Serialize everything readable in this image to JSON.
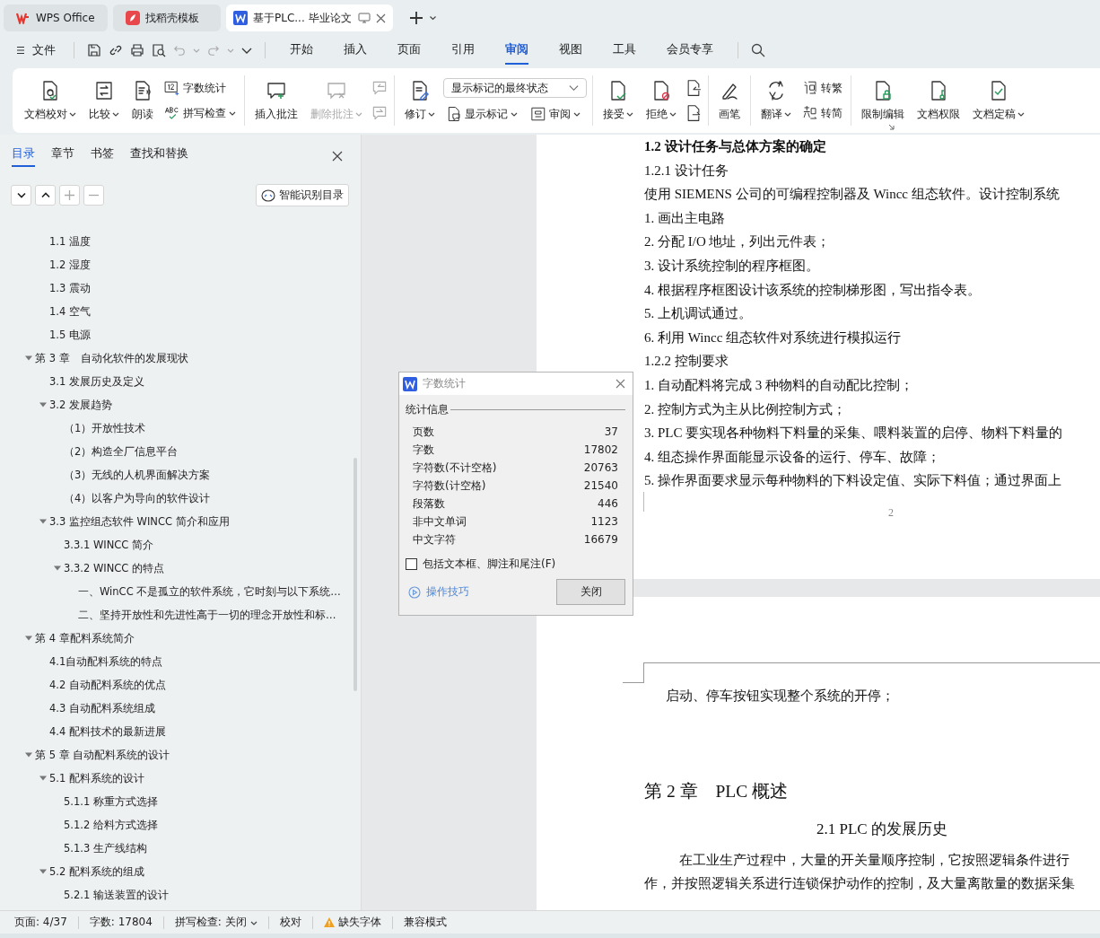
{
  "app_tabs": [
    {
      "kind": "wps",
      "label": "WPS Office",
      "selected": false
    },
    {
      "kind": "template",
      "label": "找稻壳模板",
      "selected": false
    },
    {
      "kind": "document",
      "label": "基于PLC... 毕业论文",
      "selected": true
    }
  ],
  "menu": {
    "file": "文件",
    "tabs": [
      {
        "label": "开始",
        "selected": false
      },
      {
        "label": "插入",
        "selected": false
      },
      {
        "label": "页面",
        "selected": false
      },
      {
        "label": "引用",
        "selected": false
      },
      {
        "label": "审阅",
        "selected": true
      },
      {
        "label": "视图",
        "selected": false
      },
      {
        "label": "工具",
        "selected": false
      },
      {
        "label": "会员专享",
        "selected": false
      }
    ]
  },
  "ribbon": {
    "groups": [
      {
        "items": [
          {
            "kind": "big",
            "label": "文档校对",
            "dropdown": true,
            "disabled": false
          },
          {
            "kind": "big",
            "label": "比较",
            "dropdown": true,
            "disabled": false
          },
          {
            "kind": "big",
            "label": "朗读",
            "dropdown": false,
            "disabled": false
          },
          {
            "kind": "stack",
            "items": [
              {
                "label": "字数统计",
                "dropdown": false
              },
              {
                "label": "拼写检查",
                "dropdown": true
              }
            ]
          }
        ]
      },
      {
        "items": [
          {
            "kind": "big",
            "label": "插入批注",
            "dropdown": false,
            "disabled": false
          },
          {
            "kind": "big",
            "label": "删除批注",
            "dropdown": true,
            "disabled": true
          },
          {
            "kind": "icons",
            "disabled": true
          }
        ]
      },
      {
        "items": [
          {
            "kind": "big",
            "label": "修订",
            "dropdown": true,
            "disabled": false
          },
          {
            "kind": "markup",
            "field": "显示标记的最终状态",
            "items": [
              {
                "label": "显示标记",
                "dropdown": true
              },
              {
                "label": "审阅",
                "dropdown": true
              }
            ]
          }
        ]
      },
      {
        "items": [
          {
            "kind": "big",
            "label": "接受",
            "dropdown": true,
            "disabled": false
          },
          {
            "kind": "big",
            "label": "拒绝",
            "dropdown": true,
            "disabled": false
          },
          {
            "kind": "icons",
            "disabled": false
          }
        ]
      },
      {
        "items": [
          {
            "kind": "big",
            "label": "画笔",
            "dropdown": false,
            "disabled": false
          }
        ]
      },
      {
        "items": [
          {
            "kind": "big",
            "label": "翻译",
            "dropdown": true,
            "disabled": false
          },
          {
            "kind": "stack",
            "items": [
              {
                "label": "转繁",
                "dropdown": false
              },
              {
                "label": "转简",
                "dropdown": false
              }
            ]
          }
        ]
      },
      {
        "items": [
          {
            "kind": "big",
            "label": "限制编辑",
            "dropdown": false,
            "disabled": false
          },
          {
            "kind": "big",
            "label": "文档权限",
            "dropdown": false,
            "disabled": false
          },
          {
            "kind": "big",
            "label": "文档定稿",
            "dropdown": true,
            "disabled": false
          }
        ]
      }
    ]
  },
  "sidebar": {
    "tabs": [
      {
        "label": "目录",
        "selected": true
      },
      {
        "label": "章节",
        "selected": false
      },
      {
        "label": "书签",
        "selected": false
      },
      {
        "label": "查找和替换",
        "selected": false
      }
    ],
    "smart_button": "智能识别目录",
    "toc": {
      "leading_items": [
        {
          "label": "1.1  温度"
        },
        {
          "label": "1.2  湿度"
        },
        {
          "label": "1.3  震动"
        },
        {
          "label": "1.4  空气"
        },
        {
          "label": "1.5  电源"
        }
      ],
      "chapters": [
        {
          "label": "第 3 章　自动化软件的发展现状",
          "expanded": true,
          "children": [
            {
              "label": "3.1 发展历史及定义"
            },
            {
              "label": "3.2 发展趋势",
              "expanded": true,
              "children": [
                {
                  "label": "（1）开放性技术"
                },
                {
                  "label": "（2）构造全厂信息平台"
                },
                {
                  "label": "（3）无线的人机界面解决方案"
                },
                {
                  "label": "（4）以客户为导向的软件设计"
                }
              ]
            },
            {
              "label": "3.3 监控组态软件 WINCC 简介和应用",
              "expanded": true,
              "children": [
                {
                  "label": "3.3.1 WINCC 简介"
                },
                {
                  "label": "3.3.2 WINCC 的特点",
                  "expanded": true,
                  "children": [
                    {
                      "label": "一、WinCC 不是孤立的软件系统，它时刻与以下系统…"
                    },
                    {
                      "label": "二、坚持开放性和先进性高于一切的理念开放性和标…"
                    }
                  ]
                }
              ]
            }
          ]
        },
        {
          "label": "第 4 章配料系统简介",
          "expanded": true,
          "children": [
            {
              "label": "4.1自动配料系统的特点"
            },
            {
              "label": "4.2  自动配料系统的优点"
            },
            {
              "label": "4.3  自动配料系统组成"
            },
            {
              "label": "4.4    配料技术的最新进展"
            }
          ]
        },
        {
          "label": "第 5 章  自动配料系统的设计",
          "expanded": true,
          "children": [
            {
              "label": "5.1  配料系统的设计",
              "expanded": true,
              "children": [
                {
                  "label": "5.1.1  称重方式选择"
                },
                {
                  "label": "5.1.2  给料方式选择"
                },
                {
                  "label": "5.1.3  生产线结构"
                }
              ]
            },
            {
              "label": "5.2  配料系统的组成",
              "expanded": true,
              "children": [
                {
                  "label": "5.2.1  输送装置的设计"
                }
              ]
            }
          ]
        }
      ]
    }
  },
  "document": {
    "page_1": [
      {
        "kind": "bold_heading",
        "text": "1.2 设计任务与总体方案的确定"
      },
      {
        "kind": "line",
        "text": "1.2.1 设计任务"
      },
      {
        "kind": "line",
        "text": "使用 SIEMENS 公司的可编程控制器及 Wincc 组态软件。设计控制系统"
      },
      {
        "kind": "line",
        "text": "1.  画出主电路"
      },
      {
        "kind": "line",
        "text": "2.  分配 I/O 地址，列出元件表；"
      },
      {
        "kind": "line",
        "text": "3.  设计系统控制的程序框图。"
      },
      {
        "kind": "line",
        "text": "4.  根据程序框图设计该系统的控制梯形图，写出指令表。"
      },
      {
        "kind": "line",
        "text": "5.  上机调试通过。"
      },
      {
        "kind": "line",
        "text": "6.  利用 Wincc 组态软件对系统进行模拟运行"
      },
      {
        "kind": "line",
        "text": "1.2.2  控制要求"
      },
      {
        "kind": "line",
        "text": "1.   自动配料将完成 3 种物料的自动配比控制；"
      },
      {
        "kind": "line",
        "text": "2.   控制方式为主从比例控制方式；"
      },
      {
        "kind": "line",
        "text": "3.   PLC 要实现各种物料下料量的采集、喂料装置的启停、物料下料量的"
      },
      {
        "kind": "line",
        "text": "4.   组态操作界面能显示设备的运行、停车、故障；"
      },
      {
        "kind": "line",
        "text": "5.   操作界面要求显示每种物料的下料设定值、实际下料值；通过界面上"
      }
    ],
    "page_number": "2",
    "page_2": [
      {
        "kind": "line",
        "text": "启动、停车按钮实现整个系统的开停；"
      },
      {
        "kind": "chapter_title",
        "text": "第 2 章　PLC 概述"
      },
      {
        "kind": "section_title",
        "text": "2.1 PLC 的发展历史"
      },
      {
        "kind": "indented",
        "text": "在工业生产过程中，大量的开关量顺序控制，它按照逻辑条件进行"
      },
      {
        "kind": "line",
        "text": "作，并按照逻辑关系进行连锁保护动作的控制，及大量离散量的数据采集"
      }
    ]
  },
  "dialog": {
    "title": "字数统计",
    "group": "统计信息",
    "stats": [
      {
        "label": "页数",
        "value": "37"
      },
      {
        "label": "字数",
        "value": "17802"
      },
      {
        "label": "字符数(不计空格)",
        "value": "20763"
      },
      {
        "label": "字符数(计空格)",
        "value": "21540"
      },
      {
        "label": "段落数",
        "value": "446"
      },
      {
        "label": "非中文单词",
        "value": "1123"
      },
      {
        "label": "中文字符",
        "value": "16679"
      }
    ],
    "include_option": {
      "label": "包括文本框、脚注和尾注(F)",
      "checked": false
    },
    "tips_link": "操作技巧",
    "close_button": "关闭"
  },
  "status_bar": [
    {
      "kind": "text",
      "label": "页面: 4/37"
    },
    {
      "kind": "text",
      "label": "字数: 17804"
    },
    {
      "kind": "dropdown",
      "label": "拼写检查: 关闭"
    },
    {
      "kind": "text",
      "label": "校对"
    },
    {
      "kind": "warning",
      "label": "缺失字体"
    },
    {
      "kind": "text",
      "label": "兼容模式"
    }
  ]
}
